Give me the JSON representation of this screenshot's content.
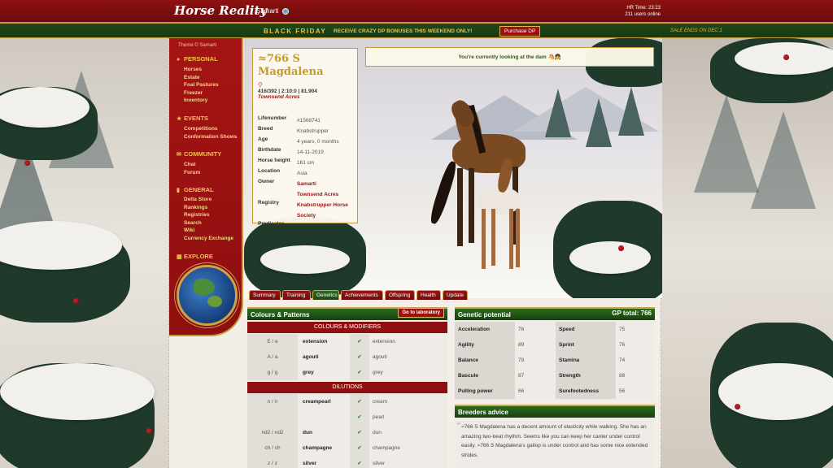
{
  "topbar": {
    "logo": "Horse Reality",
    "username": "Samarti",
    "hr_time": "HR Time: 23:23",
    "users_online": "211 users online"
  },
  "banner": {
    "title": "BLACK FRIDAY",
    "message": "RECEIVE CRAZY DP BONUSES THIS WEEKEND ONLY!",
    "button": "Purchase DP",
    "ends": "SALE ENDS ON DEC 1"
  },
  "sidebar": {
    "theme": "Theme © Samarti",
    "sections": [
      {
        "title": "PERSONAL",
        "icon": "user-circle-icon",
        "items": [
          "Horses",
          "Estate",
          "Foal Pastures",
          "Freezer",
          "Inventory"
        ]
      },
      {
        "title": "EVENTS",
        "icon": "star-icon",
        "items": [
          "Competitions",
          "Conformation Shows"
        ]
      },
      {
        "title": "COMMUNITY",
        "icon": "chat-icon",
        "items": [
          "Chat",
          "Forum"
        ]
      },
      {
        "title": "GENERAL",
        "icon": "bookmark-icon",
        "items": [
          "Delta Store",
          "Rankings",
          "Registries",
          "Search",
          "Wiki",
          "Currency Exchange"
        ]
      },
      {
        "title": "EXPLORE",
        "icon": "map-icon",
        "items": []
      }
    ]
  },
  "horse": {
    "name": "≈766 S Magdalena",
    "stats": "416/392 | 2:10:0 | 81.904",
    "farm": "Townsend Acres",
    "fields": [
      {
        "key": "Lifenumber",
        "value": "#1568741",
        "link": false
      },
      {
        "key": "Breed",
        "value": "Knabstrupper",
        "link": false
      },
      {
        "key": "Age",
        "value": "4 years, 0 months",
        "link": false
      },
      {
        "key": "Birthdate",
        "value": "14-11-2019",
        "link": false
      },
      {
        "key": "Horse height",
        "value": "161 cm",
        "link": false
      },
      {
        "key": "Location",
        "value": "Asia",
        "link": false
      },
      {
        "key": "Owner",
        "value": "Samarti",
        "link": true
      },
      {
        "key": "",
        "value": "Townsend Acres",
        "link": true
      },
      {
        "key": "Registry",
        "value": "Knabstrupper Horse Society",
        "link": true
      },
      {
        "key": "Predicates",
        "value": "",
        "link": false
      }
    ],
    "dam_note": "You're currently looking at the dam"
  },
  "tabs": [
    "Summary",
    "Training",
    "Genetics",
    "Achievements",
    "Offspring",
    "Health",
    "Update"
  ],
  "active_tab": "Genetics",
  "colours": {
    "title": "Colours & Patterns",
    "lab_button": "Go to laboratory",
    "modifiers_header": "COLOURS & MODIFIERS",
    "modifiers": [
      {
        "geno": "E / e",
        "name": "extension",
        "check": "✔",
        "result": "extension"
      },
      {
        "geno": "A / a",
        "name": "agouti",
        "check": "✔",
        "result": "agouti"
      },
      {
        "geno": "g / g",
        "name": "grey",
        "check": "✔",
        "result": "grey"
      }
    ],
    "dilutions_header": "DILUTIONS",
    "dilutions": [
      {
        "geno": "n / n",
        "name": "creampearl",
        "check": "✔",
        "result": "cream"
      },
      {
        "geno": "",
        "name": "",
        "check": "✔",
        "result": "pearl"
      },
      {
        "geno": "nd2 / nd2",
        "name": "dun",
        "check": "✔",
        "result": "dun"
      },
      {
        "geno": "ch / ch",
        "name": "champagne",
        "check": "✔",
        "result": "champagne"
      },
      {
        "geno": "z / z",
        "name": "silver",
        "check": "✔",
        "result": "silver"
      }
    ]
  },
  "genetic": {
    "title": "Genetic potential",
    "total": "GP total: 766",
    "rows": [
      [
        {
          "k": "Acceleration",
          "v": "76"
        },
        {
          "k": "Speed",
          "v": "75"
        }
      ],
      [
        {
          "k": "Agility",
          "v": "89"
        },
        {
          "k": "Sprint",
          "v": "76"
        }
      ],
      [
        {
          "k": "Balance",
          "v": "79"
        },
        {
          "k": "Stamina",
          "v": "74"
        }
      ],
      [
        {
          "k": "Bascule",
          "v": "87"
        },
        {
          "k": "Strength",
          "v": "88"
        }
      ],
      [
        {
          "k": "Pulling power",
          "v": "66"
        },
        {
          "k": "Surefootedness",
          "v": "56"
        }
      ]
    ]
  },
  "breeders": {
    "title": "Breeders advice",
    "text": "≈766 S Magdalena has a decent amount of elasticity while walking. She has an amazing two-beat rhythm. Seems like you can keep her canter under control easily. ≈766 S Magdalena's gallop is under control and has some nice extended strides."
  }
}
